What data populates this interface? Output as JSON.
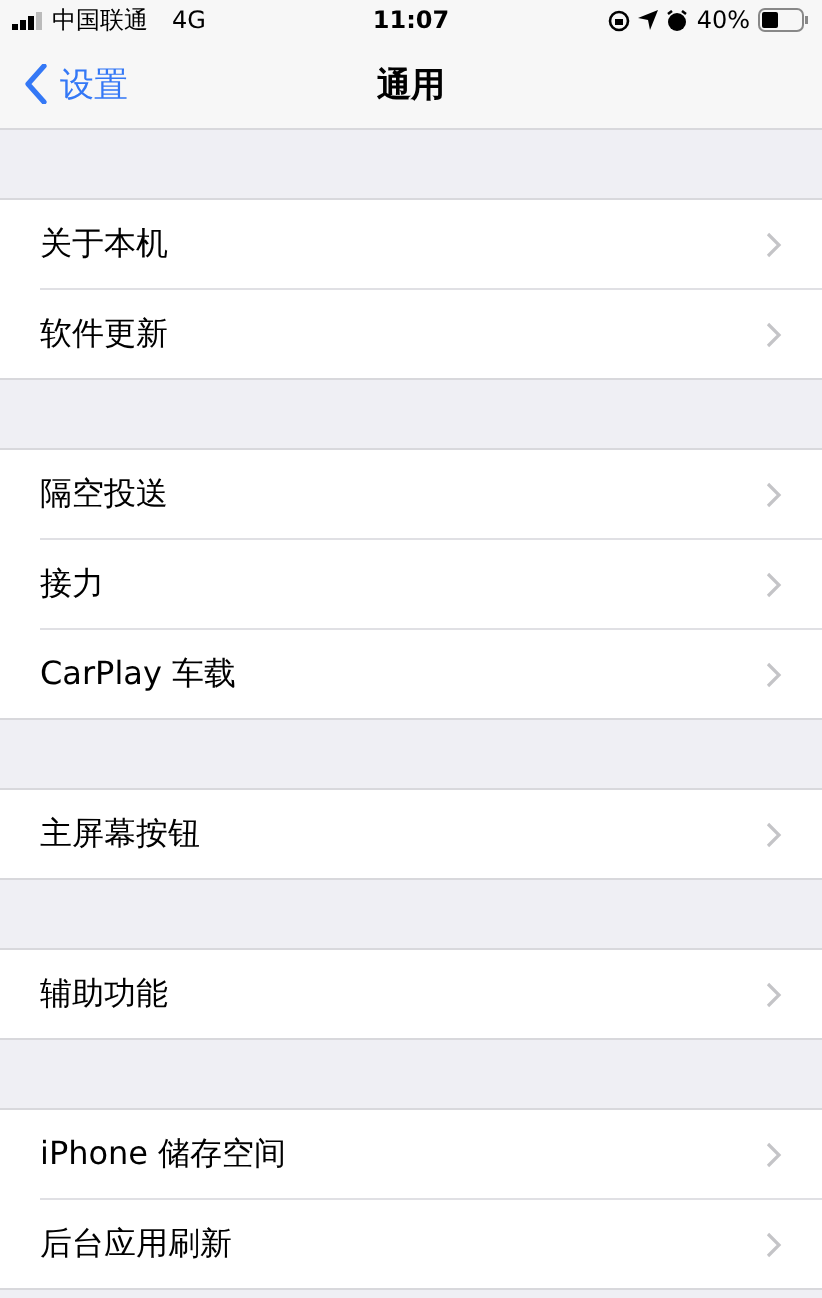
{
  "status_bar": {
    "carrier": "中国联通",
    "network": "4G",
    "time": "11:07",
    "battery": "40%"
  },
  "nav": {
    "back": "设置",
    "title": "通用"
  },
  "groups": [
    {
      "items": [
        {
          "label": "关于本机"
        },
        {
          "label": "软件更新"
        }
      ]
    },
    {
      "items": [
        {
          "label": "隔空投送"
        },
        {
          "label": "接力"
        },
        {
          "label": "CarPlay 车载"
        }
      ]
    },
    {
      "items": [
        {
          "label": "主屏幕按钮"
        }
      ]
    },
    {
      "items": [
        {
          "label": "辅助功能"
        }
      ]
    },
    {
      "items": [
        {
          "label": "iPhone 储存空间"
        },
        {
          "label": "后台应用刷新"
        }
      ]
    }
  ]
}
